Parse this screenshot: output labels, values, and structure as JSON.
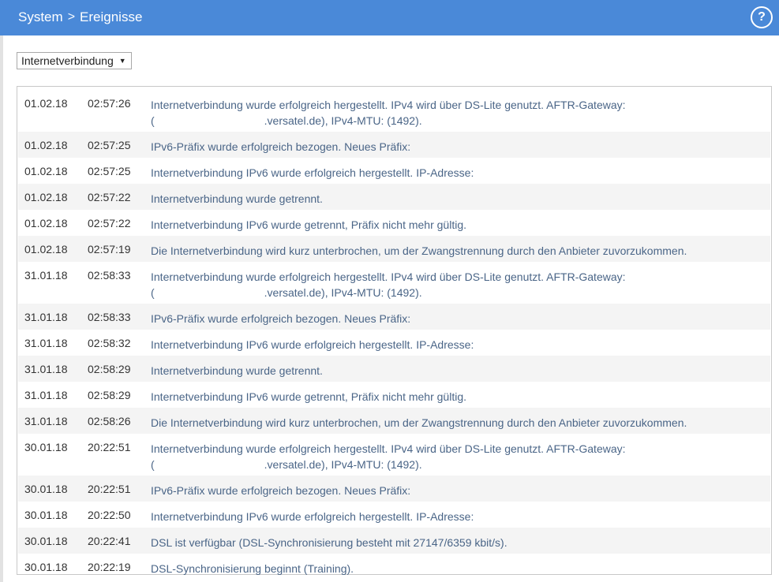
{
  "breadcrumb": {
    "root": "System",
    "separator": ">",
    "current": "Ereignisse"
  },
  "help": {
    "label": "?"
  },
  "filter": {
    "selected": "Internetverbindung"
  },
  "events": [
    {
      "date": "01.02.18",
      "time": "02:57:26",
      "line1": "Internetverbindung wurde erfolgreich hergestellt. IPv4 wird über DS-Lite genutzt. AFTR-Gateway:",
      "line2_open": "(",
      "line2": ".versatel.de), IPv4-MTU: (1492)."
    },
    {
      "date": "01.02.18",
      "time": "02:57:25",
      "line1": "IPv6-Präfix wurde erfolgreich bezogen. Neues Präfix:"
    },
    {
      "date": "01.02.18",
      "time": "02:57:25",
      "line1": "Internetverbindung IPv6 wurde erfolgreich hergestellt. IP-Adresse:"
    },
    {
      "date": "01.02.18",
      "time": "02:57:22",
      "line1": "Internetverbindung wurde getrennt."
    },
    {
      "date": "01.02.18",
      "time": "02:57:22",
      "line1": "Internetverbindung IPv6 wurde getrennt, Präfix nicht mehr gültig."
    },
    {
      "date": "01.02.18",
      "time": "02:57:19",
      "line1": "Die Internetverbindung wird kurz unterbrochen, um der Zwangstrennung durch den Anbieter zuvorzukommen."
    },
    {
      "date": "31.01.18",
      "time": "02:58:33",
      "line1": "Internetverbindung wurde erfolgreich hergestellt. IPv4 wird über DS-Lite genutzt. AFTR-Gateway:",
      "line2_open": "(",
      "line2": ".versatel.de), IPv4-MTU: (1492)."
    },
    {
      "date": "31.01.18",
      "time": "02:58:33",
      "line1": "IPv6-Präfix wurde erfolgreich bezogen. Neues Präfix:"
    },
    {
      "date": "31.01.18",
      "time": "02:58:32",
      "line1": "Internetverbindung IPv6 wurde erfolgreich hergestellt. IP-Adresse:"
    },
    {
      "date": "31.01.18",
      "time": "02:58:29",
      "line1": "Internetverbindung wurde getrennt."
    },
    {
      "date": "31.01.18",
      "time": "02:58:29",
      "line1": "Internetverbindung IPv6 wurde getrennt, Präfix nicht mehr gültig."
    },
    {
      "date": "31.01.18",
      "time": "02:58:26",
      "line1": "Die Internetverbindung wird kurz unterbrochen, um der Zwangstrennung durch den Anbieter zuvorzukommen."
    },
    {
      "date": "30.01.18",
      "time": "20:22:51",
      "line1": "Internetverbindung wurde erfolgreich hergestellt. IPv4 wird über DS-Lite genutzt. AFTR-Gateway:",
      "line2_open": "(",
      "line2": ".versatel.de), IPv4-MTU: (1492)."
    },
    {
      "date": "30.01.18",
      "time": "20:22:51",
      "line1": "IPv6-Präfix wurde erfolgreich bezogen. Neues Präfix:"
    },
    {
      "date": "30.01.18",
      "time": "20:22:50",
      "line1": "Internetverbindung IPv6 wurde erfolgreich hergestellt. IP-Adresse:"
    },
    {
      "date": "30.01.18",
      "time": "20:22:41",
      "line1": "DSL ist verfügbar (DSL-Synchronisierung besteht mit 27147/6359 kbit/s)."
    },
    {
      "date": "30.01.18",
      "time": "20:22:19",
      "line1": "DSL-Synchronisierung beginnt (Training)."
    }
  ]
}
